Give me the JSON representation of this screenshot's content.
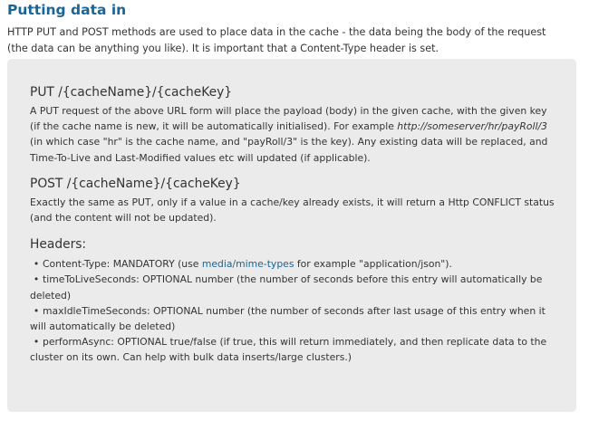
{
  "title": "Putting data in",
  "intro": "HTTP PUT and POST methods are used to place data in the cache - the data being the body of the request (the data can be anything you like). It is important that a Content-Type header is set.",
  "put": {
    "heading": "PUT /{cacheName}/{cacheKey}",
    "text_before": "A PUT request of the above URL form will place the payload (body) in the given cache, with the given key (if the cache name is new, it will be automatically initialised). For example ",
    "example_url": "http://someserver/hr/payRoll/3",
    "text_after": " (in which case \"hr\" is the cache name, and \"payRoll/3\" is the key). Any existing data will be replaced, and Time-To-Live and Last-Modified values etc will updated (if applicable)."
  },
  "post": {
    "heading": "POST /{cacheName}/{cacheKey}",
    "text": "Exactly the same as PUT, only if a value in a cache/key already exists, it will return a Http CONFLICT status (and the content will not be updated)."
  },
  "headers": {
    "heading": "Headers:",
    "bullet": "•",
    "content_type_before": "Content-Type: MANDATORY (use ",
    "content_type_link": "media/mime-types",
    "content_type_after": " for example \"application/json\").",
    "items": [
      "timeToLiveSeconds: OPTIONAL number (the number of seconds before this entry will automatically be deleted)",
      "maxIdleTimeSeconds: OPTIONAL number (the number of seconds after last usage of this entry when it will automatically be deleted)",
      "performAsync: OPTIONAL true/false (if true, this will return immediately, and then replicate data to the cluster on its own. Can help with bulk data inserts/large clusters.)"
    ]
  },
  "colors": {
    "title": "#1a6496",
    "link": "#1a6496",
    "box_background": "#ebebeb",
    "text": "#333333"
  }
}
